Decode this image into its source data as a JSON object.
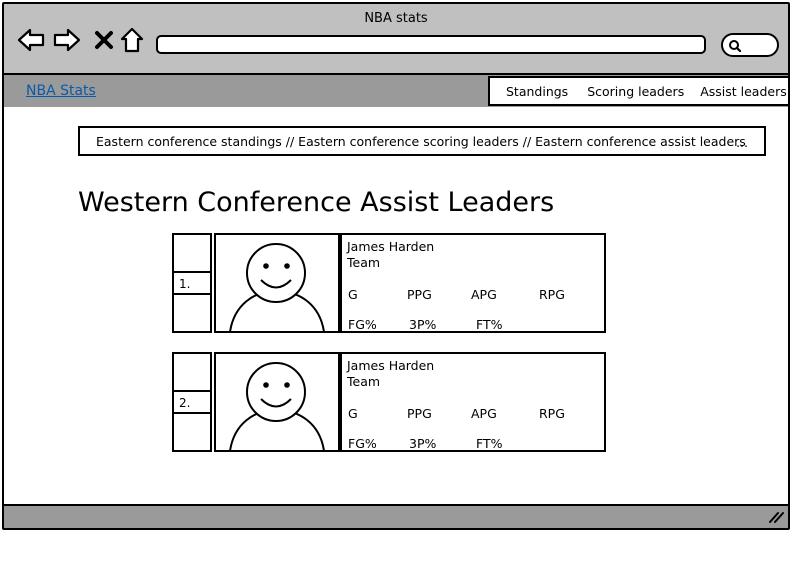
{
  "window": {
    "title": "NBA stats"
  },
  "toolbar": {
    "back": "back-icon",
    "forward": "forward-icon",
    "stop": "close-icon",
    "home": "home-icon",
    "search": "search-icon"
  },
  "nav": {
    "brand": "NBA Stats",
    "menu": [
      "Standings",
      "Scoring leaders",
      "Assist leaders"
    ]
  },
  "breadcrumb": {
    "text": "Eastern conference standings // Eastern conference scoring leaders // Eastern conference assist leaders",
    "ellipsis": "..."
  },
  "page": {
    "heading": "Western Conference Assist Leaders"
  },
  "cards": [
    {
      "rank": "1.",
      "name": "James Harden",
      "team": "Team",
      "stats_row1": [
        "G",
        "PPG",
        "APG",
        "RPG"
      ],
      "stats_row2": [
        "FG%",
        "3P%",
        "FT%"
      ]
    },
    {
      "rank": "2.",
      "name": "James Harden",
      "team": "Team",
      "stats_row1": [
        "G",
        "PPG",
        "APG",
        "RPG"
      ],
      "stats_row2": [
        "FG%",
        "3P%",
        "FT%"
      ]
    }
  ],
  "statusbar": {
    "resize": "resize-grip-icon"
  }
}
